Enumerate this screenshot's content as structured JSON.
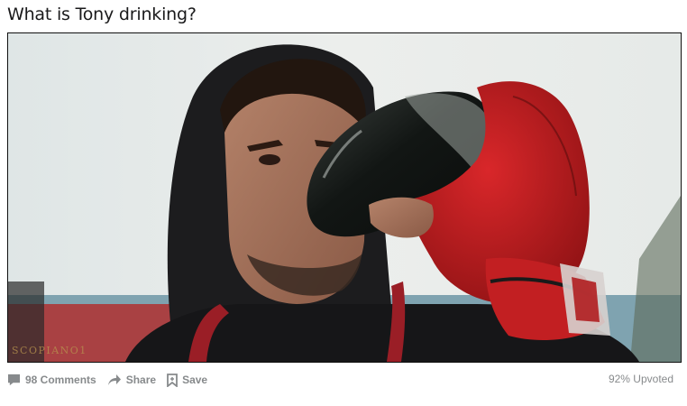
{
  "post": {
    "title": "What is Tony drinking?",
    "image_alt": "Man in a black hoodie drinking green liquid from a bottle while wearing a red glove",
    "watermark": "SCOPIANO1"
  },
  "actions": {
    "comments_label": "98 Comments",
    "share_label": "Share",
    "save_label": "Save"
  },
  "stats": {
    "upvoted_label": "92% Upvoted"
  },
  "icons": {
    "comments": "comment-icon",
    "share": "share-arrow-icon",
    "save": "bookmark-icon"
  }
}
